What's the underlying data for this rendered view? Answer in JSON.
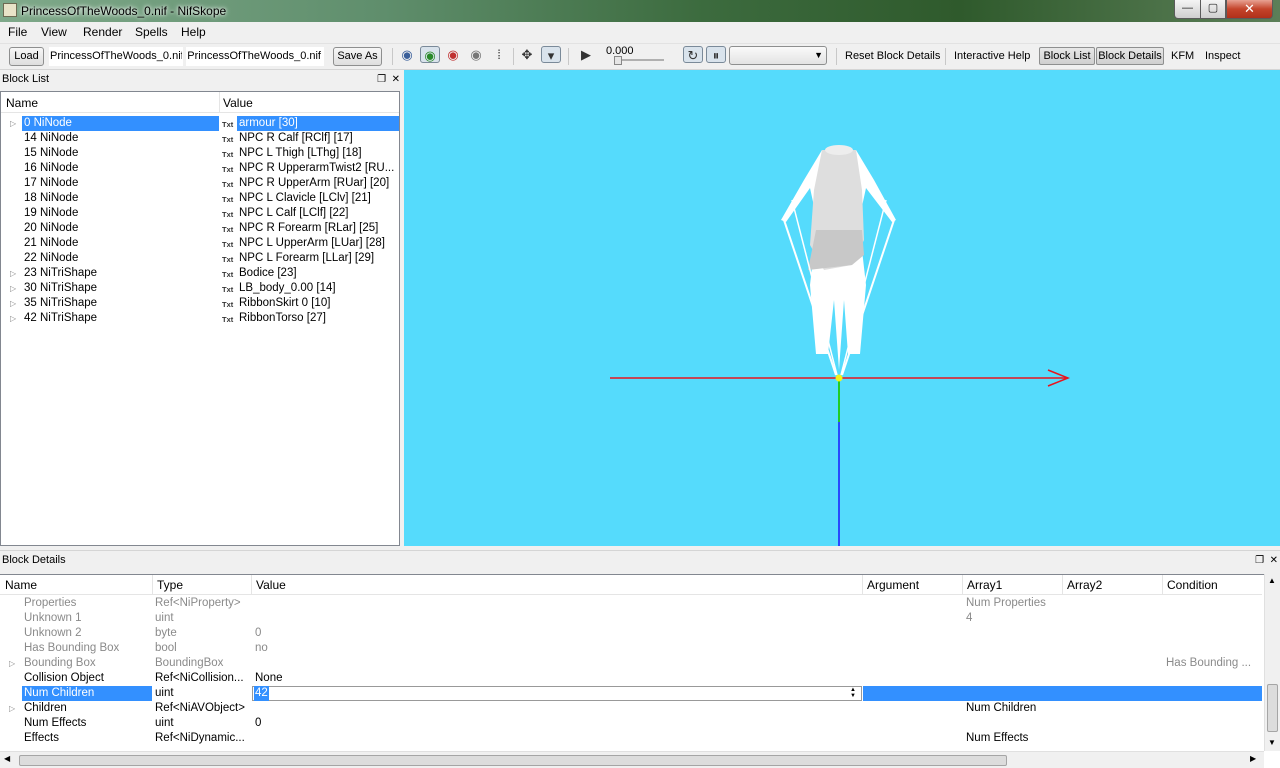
{
  "window": {
    "title": "PrincessOfTheWoods_0.nif - NifSkope",
    "min": "—",
    "max": "▢",
    "close": "✕"
  },
  "menu": [
    "File",
    "View",
    "Render",
    "Spells",
    "Help"
  ],
  "toolbar": {
    "load": "Load",
    "path1": "PrincessOfTheWoods_0.nif",
    "path2": "PrincessOfTheWoods_0.nif",
    "save_as": "Save As",
    "time": "0.000",
    "reset_block_details": "Reset Block Details",
    "interactive_help": "Interactive Help",
    "block_list": "Block List",
    "block_details": "Block Details",
    "kfm": "KFM",
    "inspect": "Inspect",
    "icons": [
      "eye-icon",
      "eye-icon",
      "eye-icon",
      "eye-icon",
      "footprints-icon",
      "axes-icon",
      "dropdown-icon",
      "play-icon",
      "loop-icon",
      "pause-icon"
    ]
  },
  "block_list": {
    "title": "Block List",
    "col_name": "Name",
    "col_value": "Value",
    "rows": [
      {
        "name": "0 NiNode",
        "value": "armour [30]",
        "expand": true,
        "selected": true
      },
      {
        "name": "14 NiNode",
        "value": "NPC R Calf [RClf] [17]",
        "expand": false
      },
      {
        "name": "15 NiNode",
        "value": "NPC L Thigh [LThg] [18]",
        "expand": false
      },
      {
        "name": "16 NiNode",
        "value": "NPC R UpperarmTwist2 [RU...",
        "expand": false
      },
      {
        "name": "17 NiNode",
        "value": "NPC R UpperArm [RUar] [20]",
        "expand": false
      },
      {
        "name": "18 NiNode",
        "value": "NPC L Clavicle [LClv] [21]",
        "expand": false
      },
      {
        "name": "19 NiNode",
        "value": "NPC L Calf [LClf] [22]",
        "expand": false
      },
      {
        "name": "20 NiNode",
        "value": "NPC R Forearm [RLar] [25]",
        "expand": false
      },
      {
        "name": "21 NiNode",
        "value": "NPC L UpperArm [LUar] [28]",
        "expand": false
      },
      {
        "name": "22 NiNode",
        "value": "NPC L Forearm [LLar] [29]",
        "expand": false
      },
      {
        "name": "23 NiTriShape",
        "value": "Bodice [23]",
        "expand": true
      },
      {
        "name": "30 NiTriShape",
        "value": "LB_body_0.00 [14]",
        "expand": true
      },
      {
        "name": "35 NiTriShape",
        "value": "RibbonSkirt 0 [10]",
        "expand": true
      },
      {
        "name": "42 NiTriShape",
        "value": "RibbonTorso [27]",
        "expand": true
      }
    ],
    "txt_tag": "Txt"
  },
  "block_details": {
    "title": "Block Details",
    "cols": [
      "Name",
      "Type",
      "Value",
      "Argument",
      "Array1",
      "Array2",
      "Condition"
    ],
    "rows": [
      {
        "name": "Properties",
        "type": "Ref<NiProperty>",
        "value": "",
        "array1": "Num Properties",
        "condition": "",
        "gray": true,
        "expand": false
      },
      {
        "name": "Unknown 1",
        "type": "uint",
        "value": "",
        "array1": "4",
        "condition": "",
        "gray": true,
        "expand": false
      },
      {
        "name": "Unknown 2",
        "type": "byte",
        "value": "0",
        "array1": "",
        "condition": "",
        "gray": true,
        "expand": false
      },
      {
        "name": "Has Bounding Box",
        "type": "bool",
        "value": "no",
        "array1": "",
        "condition": "",
        "gray": true,
        "expand": false
      },
      {
        "name": "Bounding Box",
        "type": "BoundingBox",
        "value": "",
        "array1": "",
        "condition": "Has Bounding ...",
        "gray": true,
        "expand": true
      },
      {
        "name": "Collision Object",
        "type": "Ref<NiCollision...",
        "value": "None",
        "array1": "",
        "condition": "",
        "gray": false,
        "expand": false
      },
      {
        "name": "Num Children",
        "type": "uint",
        "value": "42",
        "array1": "",
        "condition": "",
        "gray": false,
        "expand": false,
        "selected": true
      },
      {
        "name": "Children",
        "type": "Ref<NiAVObject>",
        "value": "",
        "array1": "Num Children",
        "condition": "",
        "gray": false,
        "expand": true,
        "icon": true
      },
      {
        "name": "Num Effects",
        "type": "uint",
        "value": "0",
        "array1": "",
        "condition": "",
        "gray": false,
        "expand": false
      },
      {
        "name": "Effects",
        "type": "Ref<NiDynamic...",
        "value": "",
        "array1": "Num Effects",
        "condition": "",
        "gray": false,
        "expand": false,
        "icon": true
      }
    ]
  },
  "colors": {
    "viewport_bg": "#55dbfc",
    "selection": "#3390ff",
    "axis_x": "#e8141e",
    "axis_y": "#22cc22",
    "axis_z": "#1a1aff"
  }
}
